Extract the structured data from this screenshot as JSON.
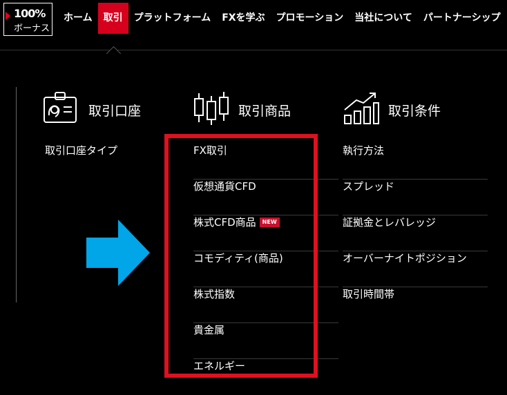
{
  "bonus": {
    "percent": "100%",
    "label": "ボーナス"
  },
  "nav": {
    "items": [
      {
        "label": "ホーム",
        "active": false
      },
      {
        "label": "取引",
        "active": true
      },
      {
        "label": "プラットフォーム",
        "active": false
      },
      {
        "label": "FXを学ぶ",
        "active": false
      },
      {
        "label": "プロモーション",
        "active": false
      },
      {
        "label": "当社について",
        "active": false
      },
      {
        "label": "パートナーシップ",
        "active": false
      }
    ]
  },
  "menu": {
    "accounts": {
      "title": "取引口座",
      "icon": "id-card-icon",
      "links": [
        "取引口座タイプ"
      ]
    },
    "products": {
      "title": "取引商品",
      "icon": "candlestick-icon",
      "links": [
        "FX取引",
        "仮想通貨CFD",
        "株式CFD商品",
        "コモディティ(商品)",
        "株式指数",
        "貴金属",
        "エネルギー"
      ],
      "new_badge": "NEW"
    },
    "conditions": {
      "title": "取引条件",
      "icon": "growth-chart-icon",
      "links": [
        "執行方法",
        "スプレッド",
        "証拠金とレバレッジ",
        "オーバーナイトポジション",
        "取引時間帯"
      ]
    }
  },
  "colors": {
    "accent": "#d6001c",
    "highlight_box": "#e0101e",
    "arrow": "#00a6e8"
  }
}
